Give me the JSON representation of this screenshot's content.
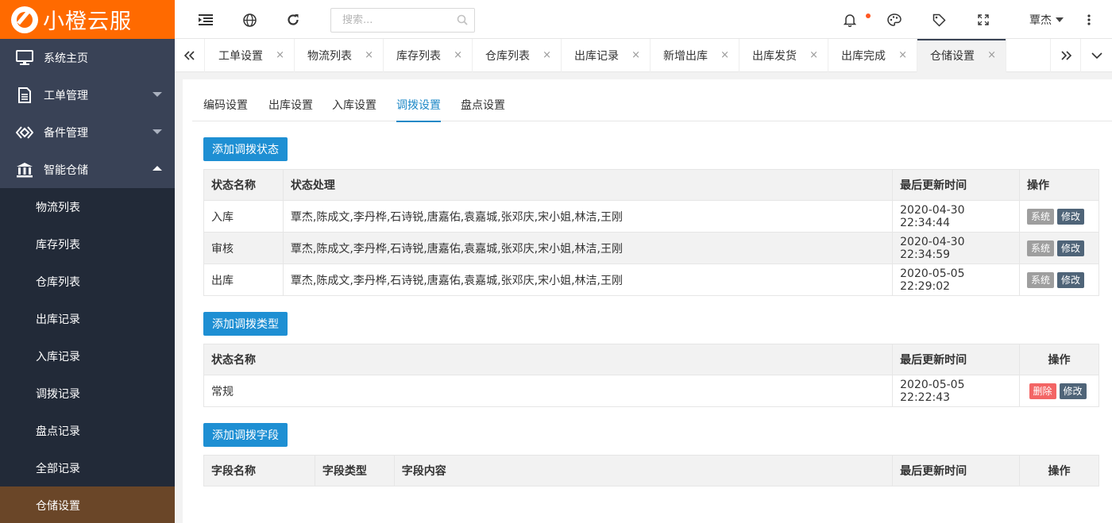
{
  "brand": {
    "name": "小橙云服",
    "color": "#ff6a00"
  },
  "sidebar": {
    "items": [
      {
        "label": "系统主页",
        "icon": "monitor-icon"
      },
      {
        "label": "工单管理",
        "icon": "document-icon"
      },
      {
        "label": "备件管理",
        "icon": "diamond-icon"
      },
      {
        "label": "智能仓储",
        "icon": "bank-icon"
      }
    ],
    "subitems": [
      {
        "label": "物流列表"
      },
      {
        "label": "库存列表"
      },
      {
        "label": "仓库列表"
      },
      {
        "label": "出库记录"
      },
      {
        "label": "入库记录"
      },
      {
        "label": "调拨记录"
      },
      {
        "label": "盘点记录"
      },
      {
        "label": "全部记录"
      },
      {
        "label": "仓储设置"
      }
    ]
  },
  "header": {
    "search_placeholder": "搜索...",
    "user": "覃杰"
  },
  "tabs": [
    {
      "label": "工单设置"
    },
    {
      "label": "物流列表"
    },
    {
      "label": "库存列表"
    },
    {
      "label": "仓库列表"
    },
    {
      "label": "出库记录"
    },
    {
      "label": "新增出库"
    },
    {
      "label": "出库发货"
    },
    {
      "label": "出库完成"
    },
    {
      "label": "仓储设置"
    }
  ],
  "tab_close": "×",
  "subtabs": [
    {
      "label": "编码设置"
    },
    {
      "label": "出库设置"
    },
    {
      "label": "入库设置"
    },
    {
      "label": "调拨设置"
    },
    {
      "label": "盘点设置"
    }
  ],
  "status_section": {
    "add_label": "添加调拨状态",
    "headers": [
      "状态名称",
      "状态处理",
      "最后更新时间",
      "操作"
    ],
    "rows": [
      {
        "name": "入库",
        "handlers": "覃杰,陈成文,李丹桦,石诗锐,唐嘉佑,袁嘉城,张邓庆,宋小姐,林洁,王刚",
        "updated": "2020-04-30 22:34:44",
        "btn1": "系统",
        "btn2": "修改"
      },
      {
        "name": "审核",
        "handlers": "覃杰,陈成文,李丹桦,石诗锐,唐嘉佑,袁嘉城,张邓庆,宋小姐,林洁,王刚",
        "updated": "2020-04-30 22:34:59",
        "btn1": "系统",
        "btn2": "修改"
      },
      {
        "name": "出库",
        "handlers": "覃杰,陈成文,李丹桦,石诗锐,唐嘉佑,袁嘉城,张邓庆,宋小姐,林洁,王刚",
        "updated": "2020-05-05 22:29:02",
        "btn1": "系统",
        "btn2": "修改"
      }
    ]
  },
  "type_section": {
    "add_label": "添加调拨类型",
    "headers": [
      "状态名称",
      "最后更新时间",
      "操作"
    ],
    "rows": [
      {
        "name": "常规",
        "updated": "2020-05-05 22:22:43",
        "btn1": "删除",
        "btn2": "修改"
      }
    ]
  },
  "field_section": {
    "add_label": "添加调拨字段",
    "headers": [
      "字段名称",
      "字段类型",
      "字段内容",
      "最后更新时间",
      "操作"
    ]
  }
}
